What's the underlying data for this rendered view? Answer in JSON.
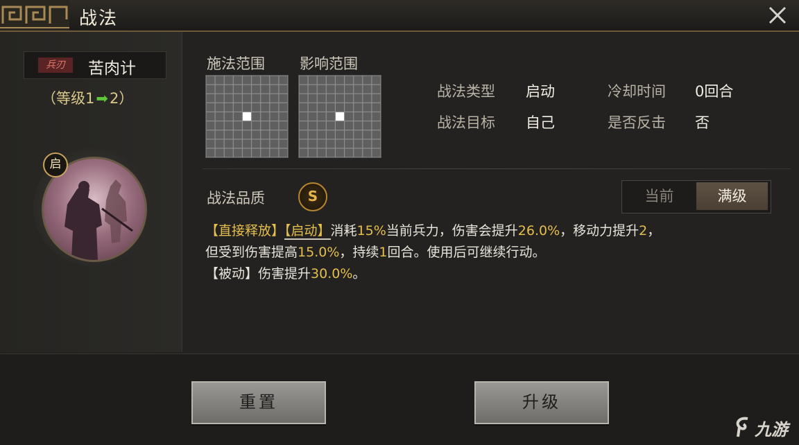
{
  "window": {
    "title": "战法"
  },
  "skill": {
    "tag": "兵刃",
    "name": "苦肉计",
    "level_prefix": "（等级1",
    "level_suffix": "2）",
    "badge": "启"
  },
  "ranges": {
    "cast_label": "施法范围",
    "effect_label": "影响范围"
  },
  "info": {
    "type_label": "战法类型",
    "type_value": "启动",
    "cooldown_label": "冷却时间",
    "cooldown_value": "0回合",
    "target_label": "战法目标",
    "target_value": "自己",
    "counter_label": "是否反击",
    "counter_value": "否"
  },
  "quality": {
    "label": "战法品质",
    "grade": "S"
  },
  "toggle": {
    "current": "当前",
    "max": "满级"
  },
  "description": {
    "line1_a": "【直接释放】",
    "line1_b": "【启动】",
    "line1_c": "消耗",
    "line1_d": "15%",
    "line1_e": "当前兵力，伤害会提升",
    "line1_f": "26.0%",
    "line1_g": "，移动力提升",
    "line1_h": "2",
    "line1_i": "，",
    "line2_a": "但受到伤害提高",
    "line2_b": "15.0%",
    "line2_c": "，持续",
    "line2_d": "1",
    "line2_e": "回合。使用后可继续行动。",
    "line3_a": "【被动】伤害提升",
    "line3_b": "30.0%",
    "line3_c": "。"
  },
  "buttons": {
    "reset": "重置",
    "upgrade": "升级"
  },
  "watermark": {
    "text": "九游"
  },
  "colors": {
    "highlight": "#e5bf4c",
    "arrow": "#5dc63a",
    "accent": "#b8862c"
  }
}
